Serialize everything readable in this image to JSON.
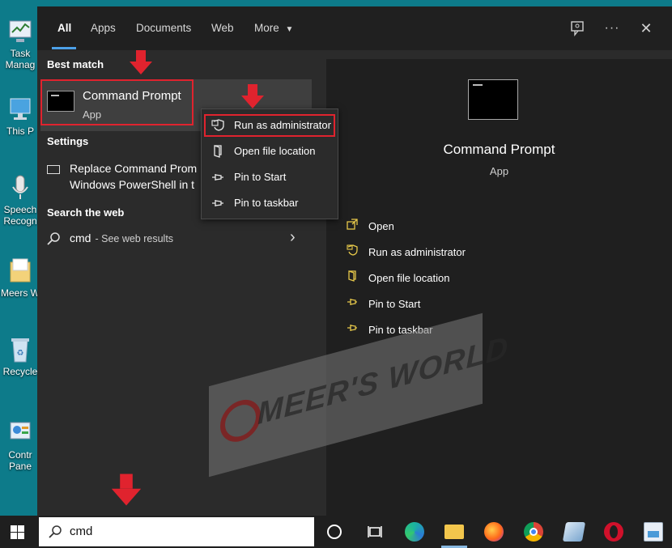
{
  "desktop": {
    "icons": [
      {
        "name": "Task Manager",
        "label": "Task\nManag"
      },
      {
        "name": "This PC",
        "label": "This P"
      },
      {
        "name": "Speech Recognition",
        "label": "Speech\nRecogn"
      },
      {
        "name": "Meers World",
        "label": "Meers W"
      },
      {
        "name": "Recycle Bin",
        "label": "Recycle"
      },
      {
        "name": "Control Panel",
        "label": "Contr\nPane"
      }
    ]
  },
  "search_panel": {
    "tabs": [
      "All",
      "Apps",
      "Documents",
      "Web",
      "More"
    ],
    "more_caret": "▼",
    "top_icons": {
      "feedback": "feedback-icon",
      "more": "···",
      "close": "✕"
    },
    "best_match_header": "Best match",
    "best_match": {
      "title": "Command Prompt",
      "subtitle": "App"
    },
    "settings_header": "Settings",
    "settings_item": {
      "line1": "Replace Command Prom",
      "line2": "Windows PowerShell in t"
    },
    "web_header": "Search the web",
    "web_item": {
      "query": "cmd",
      "suffix": " - See web results",
      "chevron": "›"
    },
    "context_menu": [
      {
        "label": "Run as administrator",
        "icon": "shield-icon"
      },
      {
        "label": "Open file location",
        "icon": "folder-icon"
      },
      {
        "label": "Pin to Start",
        "icon": "pin-icon"
      },
      {
        "label": "Pin to taskbar",
        "icon": "pin-icon"
      }
    ],
    "preview": {
      "title": "Command Prompt",
      "subtitle": "App",
      "actions": [
        {
          "label": "Open",
          "icon": "open-icon"
        },
        {
          "label": "Run as administrator",
          "icon": "shield-icon"
        },
        {
          "label": "Open file location",
          "icon": "folder-icon"
        },
        {
          "label": "Pin to Start",
          "icon": "pin-icon"
        },
        {
          "label": "Pin to taskbar",
          "icon": "pin-icon"
        }
      ]
    }
  },
  "watermark": {
    "text": "MEER'S WORLD"
  },
  "taskbar": {
    "search_value": "cmd",
    "icons": [
      "windows-icon",
      "cortana-icon",
      "task-view-icon",
      "edge-icon",
      "file-explorer-icon",
      "firefox-icon",
      "chrome-icon",
      "app-icon",
      "opera-icon",
      "paint-icon"
    ]
  },
  "colors": {
    "highlight_red": "#e0232e",
    "accent_blue": "#4ca0e8",
    "action_icon_yellow": "#e6c84a",
    "desktop_teal": "#0d7b8a"
  }
}
